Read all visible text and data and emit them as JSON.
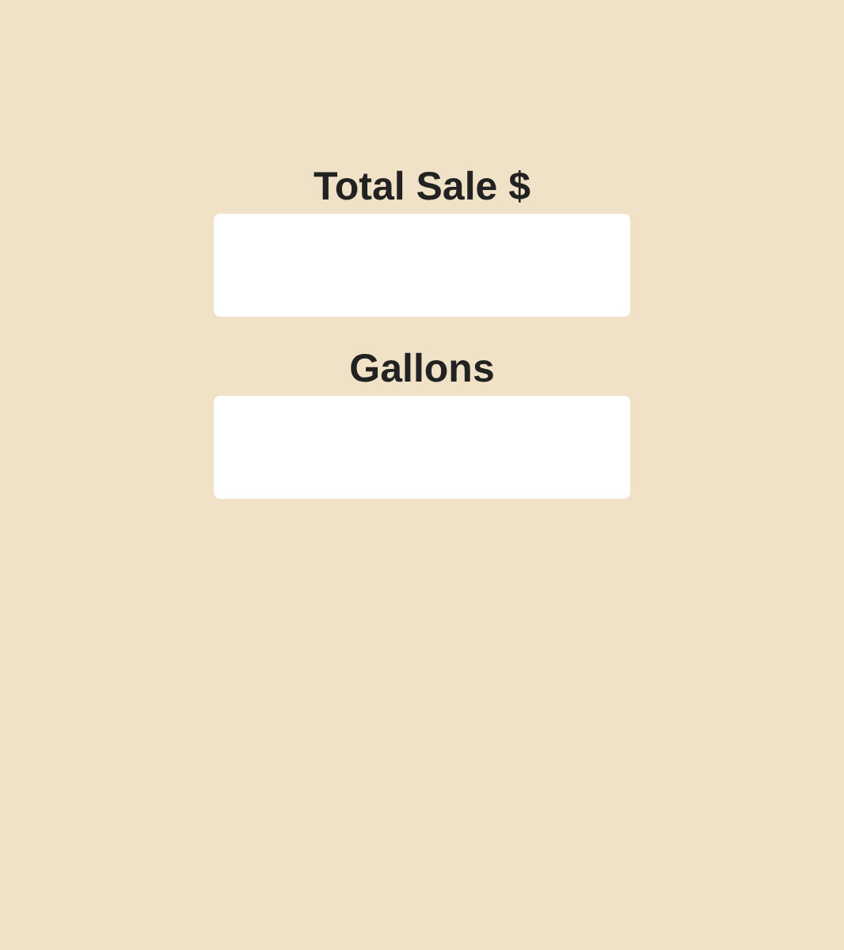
{
  "fields": [
    {
      "label": "Total Sale $"
    },
    {
      "label": "Gallons"
    }
  ]
}
